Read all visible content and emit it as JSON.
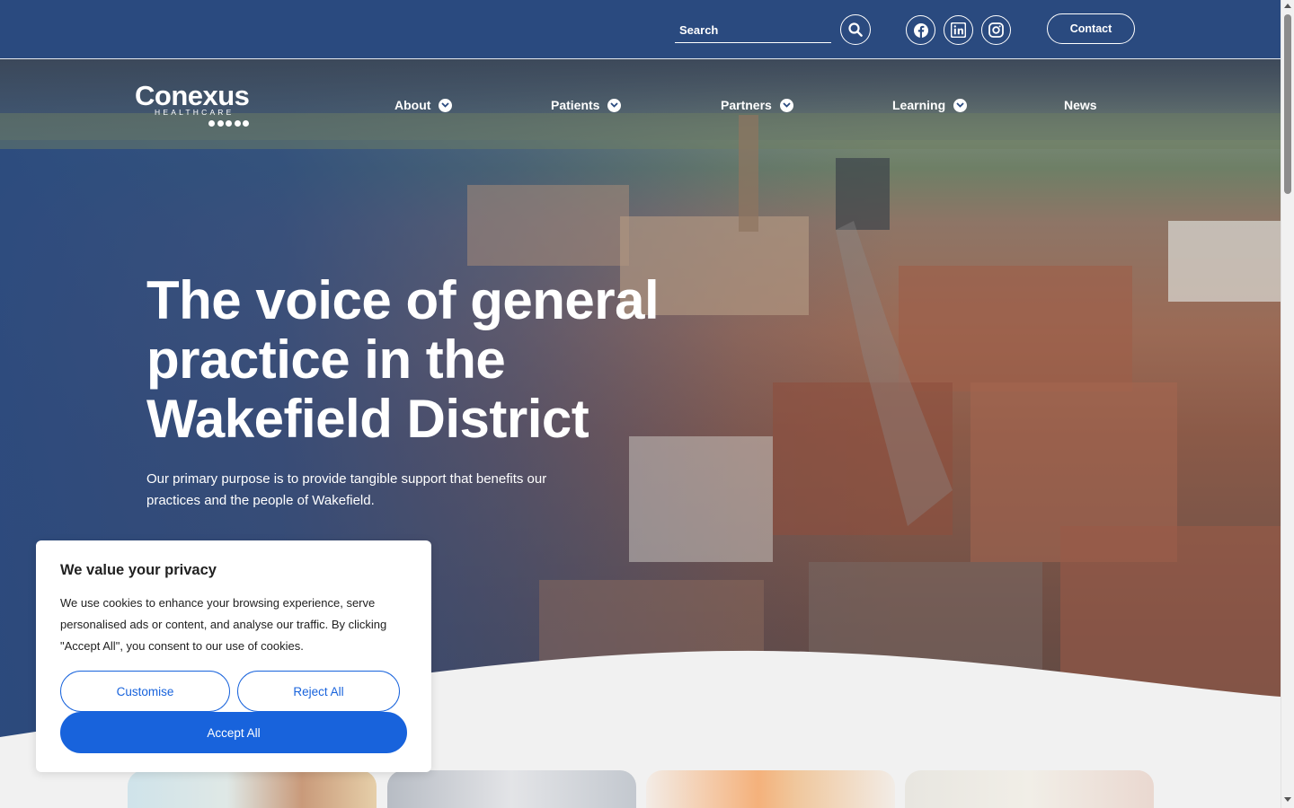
{
  "header": {
    "search": {
      "placeholder": "Search",
      "value": ""
    },
    "search_icon": "search-icon",
    "social": [
      {
        "name": "facebook",
        "icon": "facebook-icon"
      },
      {
        "name": "linkedin",
        "icon": "linkedin-icon"
      },
      {
        "name": "instagram",
        "icon": "instagram-icon"
      }
    ],
    "contact_label": "Contact",
    "bg_color": "#2a4a7f"
  },
  "logo": {
    "word": "Conexus",
    "sub": "HEALTHCARE"
  },
  "nav": [
    {
      "label": "About",
      "has_dropdown": true
    },
    {
      "label": "Patients",
      "has_dropdown": true
    },
    {
      "label": "Partners",
      "has_dropdown": true
    },
    {
      "label": "Learning",
      "has_dropdown": true
    },
    {
      "label": "News",
      "has_dropdown": false
    }
  ],
  "hero": {
    "title": "The voice of general practice in the Wakefield District",
    "subtitle": "Our primary purpose is to provide tangible support that benefits our practices and the people of Wakefield."
  },
  "cookie": {
    "title": "We value your privacy",
    "text": "We use cookies to enhance your browsing experience, serve personalised ads or content, and analyse our traffic. By clicking \"Accept All\", you consent to our use of cookies.",
    "customise_label": "Customise",
    "reject_label": "Reject All",
    "accept_label": "Accept All",
    "accent_color": "#1863dc"
  }
}
